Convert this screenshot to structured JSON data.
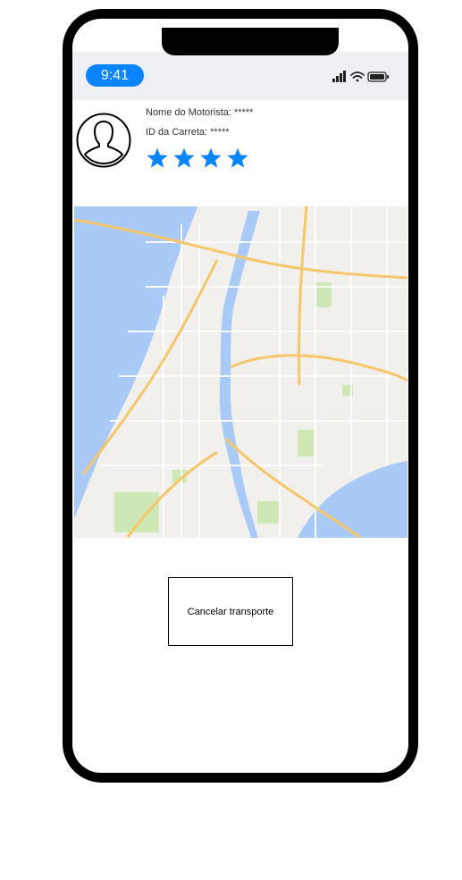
{
  "status_bar": {
    "time": "9:41",
    "icons": [
      "signal-icon",
      "wifi-icon",
      "battery-icon"
    ],
    "time_pill_color": "#0a84ff"
  },
  "driver": {
    "name_label": "Nome do Motorista: *****",
    "trailer_label": "ID da Carreta: *****",
    "rating": 4,
    "rating_max": 4,
    "star_color": "#0a84ff",
    "avatar_icon": "user-silhouette-icon"
  },
  "map": {
    "icon": "city-map"
  },
  "actions": {
    "cancel_label": "Cancelar transporte"
  }
}
